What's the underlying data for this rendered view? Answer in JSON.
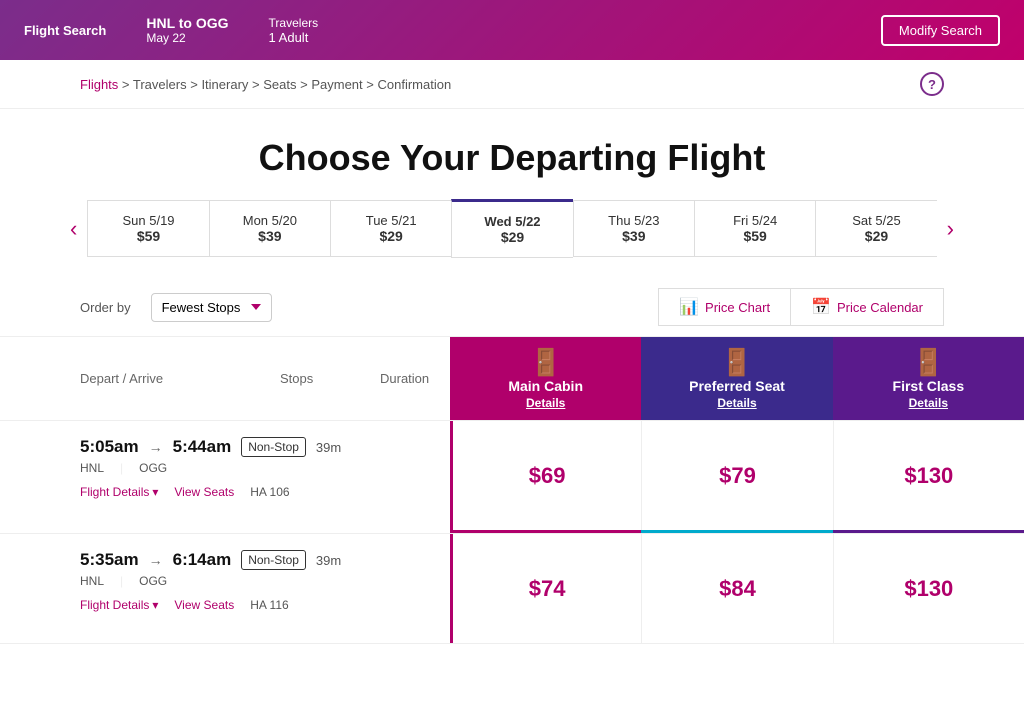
{
  "header": {
    "nav_label": "Flight Search",
    "route": "HNL to OGG",
    "date": "May 22",
    "travelers_label": "Travelers",
    "travelers_value": "1 Adult",
    "modify_btn": "Modify Search"
  },
  "breadcrumb": {
    "items": [
      "Flights",
      "Travelers",
      "Itinerary",
      "Seats",
      "Payment",
      "Confirmation"
    ]
  },
  "page_title": "Choose Your Departing Flight",
  "date_tabs": [
    {
      "day": "Sun 5/19",
      "price": "$59",
      "active": false
    },
    {
      "day": "Mon 5/20",
      "price": "$39",
      "active": false
    },
    {
      "day": "Tue 5/21",
      "price": "$29",
      "active": false
    },
    {
      "day": "Wed 5/22",
      "price": "$29",
      "active": true
    },
    {
      "day": "Thu 5/23",
      "price": "$39",
      "active": false
    },
    {
      "day": "Fri 5/24",
      "price": "$59",
      "active": false
    },
    {
      "day": "Sat 5/25",
      "price": "$29",
      "active": false
    }
  ],
  "order_by": {
    "label": "Order by",
    "value": "Fewest Stops"
  },
  "chart_buttons": {
    "price_chart": "Price Chart",
    "price_calendar": "Price Calendar"
  },
  "columns": {
    "depart_arrive": "Depart / Arrive",
    "stops": "Stops",
    "duration": "Duration"
  },
  "cabins": [
    {
      "name": "Main Cabin",
      "details": "Details",
      "type": "main"
    },
    {
      "name": "Preferred Seat",
      "details": "Details",
      "type": "preferred"
    },
    {
      "name": "First Class",
      "details": "Details",
      "type": "first"
    }
  ],
  "flights": [
    {
      "depart_time": "5:05am",
      "arrive_time": "5:44am",
      "depart_airport": "HNL",
      "arrive_airport": "OGG",
      "stops": "Non-Stop",
      "duration": "39m",
      "flight_details": "Flight Details",
      "view_seats": "View Seats",
      "flight_number": "HA 106",
      "prices": {
        "main": "$69",
        "preferred": "$79",
        "first": "$130"
      }
    },
    {
      "depart_time": "5:35am",
      "arrive_time": "6:14am",
      "depart_airport": "HNL",
      "arrive_airport": "OGG",
      "stops": "Non-Stop",
      "duration": "39m",
      "flight_details": "Flight Details",
      "view_seats": "View Seats",
      "flight_number": "HA 116",
      "prices": {
        "main": "$74",
        "preferred": "$84",
        "first": "$130"
      }
    }
  ]
}
